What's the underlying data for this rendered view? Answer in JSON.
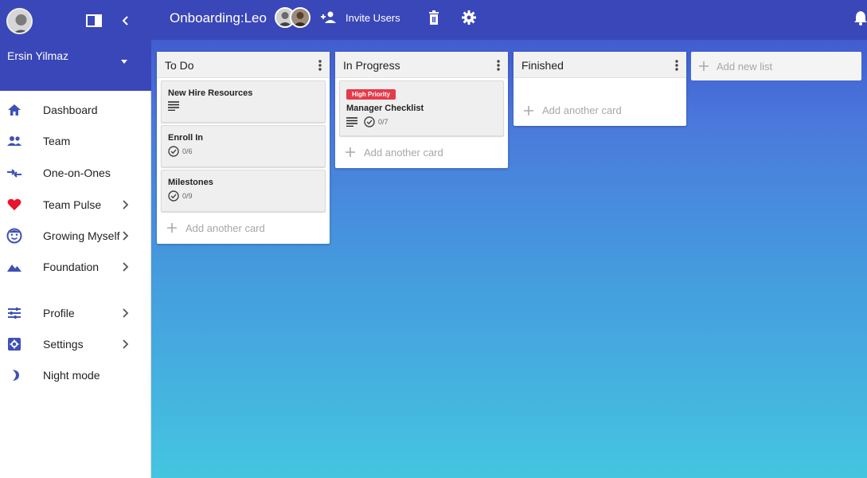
{
  "sidebar": {
    "user_name": "Ersin Yilmaz",
    "items": [
      {
        "label": "Dashboard",
        "icon": "home-icon",
        "chevron": false
      },
      {
        "label": "Team",
        "icon": "group-icon",
        "chevron": false
      },
      {
        "label": "One-on-Ones",
        "icon": "compare-arrows-icon",
        "chevron": false
      },
      {
        "label": "Team Pulse",
        "icon": "heart-icon",
        "chevron": true
      },
      {
        "label": "Growing Myself",
        "icon": "smiley-icon",
        "chevron": true
      },
      {
        "label": "Foundation",
        "icon": "landscape-icon",
        "chevron": true
      },
      {
        "label": "Profile",
        "icon": "sliders-icon",
        "chevron": true
      },
      {
        "label": "Settings",
        "icon": "settings-box-icon",
        "chevron": true
      },
      {
        "label": "Night mode",
        "icon": "moon-icon",
        "chevron": false
      }
    ]
  },
  "topbar": {
    "board_title": "Onboarding:Leo",
    "invite_label": "Invite Users"
  },
  "lists": [
    {
      "title": "To Do",
      "cards": [
        {
          "title": "New Hire Resources",
          "has_description": true,
          "checklist": ""
        },
        {
          "title": "Enroll In",
          "has_description": false,
          "checklist": "0/6"
        },
        {
          "title": "Milestones",
          "has_description": false,
          "checklist": "0/9"
        }
      ],
      "add_card_label": "Add another card"
    },
    {
      "title": "In Progress",
      "cards": [
        {
          "title": "Manager Checklist",
          "label": "High Priority",
          "has_description": true,
          "checklist": "0/7"
        }
      ],
      "add_card_label": "Add another card"
    },
    {
      "title": "Finished",
      "cards": [],
      "add_card_label": "Add another card"
    }
  ],
  "add_list_label": "Add new list",
  "colors": {
    "primary": "#3a47b8",
    "accent": "#3f51b5",
    "priority": "#e53a4a",
    "heart": "#e8142d"
  }
}
